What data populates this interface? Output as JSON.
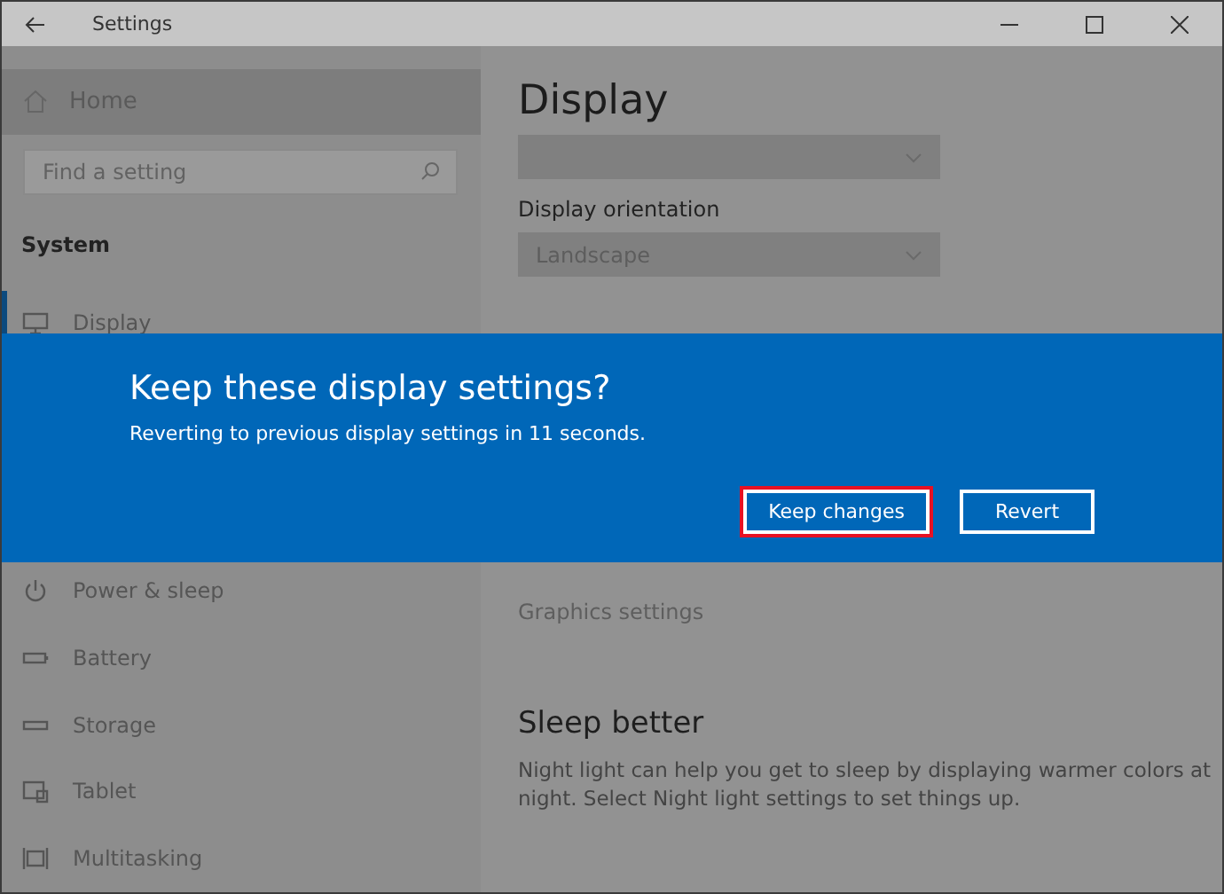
{
  "window": {
    "title": "Settings"
  },
  "sidebar": {
    "home": {
      "label": "Home",
      "highlighted": true
    },
    "search": {
      "placeholder": "Find a setting"
    },
    "section": "System",
    "items_above": [
      {
        "label": "Display",
        "kind": "monitor",
        "selected": true
      }
    ],
    "items_below": [
      {
        "label": "Power & sleep",
        "kind": "power",
        "selected": false
      },
      {
        "label": "Battery",
        "kind": "battery",
        "selected": false
      },
      {
        "label": "Storage",
        "kind": "storage",
        "selected": false
      },
      {
        "label": "Tablet",
        "kind": "tablet",
        "selected": false
      },
      {
        "label": "Multitasking",
        "kind": "multitask",
        "selected": false
      }
    ]
  },
  "content": {
    "title": "Display",
    "orientation": {
      "label": "Display orientation",
      "value": "Landscape"
    },
    "links": [
      "Graphics settings"
    ],
    "sleep": {
      "heading": "Sleep better",
      "text": "Night light can help you get to sleep by displaying warmer colors at night. Select Night light settings to set things up."
    }
  },
  "dialog": {
    "title": "Keep these display settings?",
    "message": "Reverting to previous display settings in 11 seconds.",
    "buttons": [
      {
        "label": "Keep changes",
        "focused": true
      },
      {
        "label": "Revert",
        "focused": false
      }
    ]
  }
}
